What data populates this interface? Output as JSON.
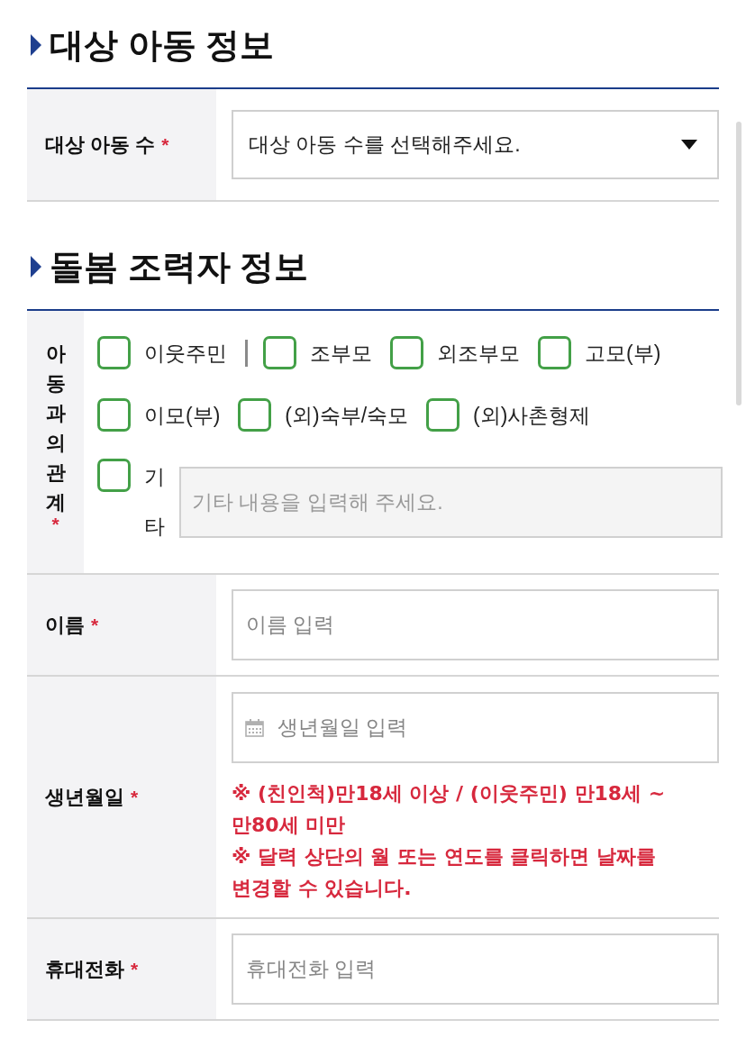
{
  "sections": [
    {
      "title": "대상 아동 정보",
      "rows": [
        {
          "kind": "select",
          "label": "대상 아동 수",
          "required_mark": "*",
          "value": "대상 아동 수를 선택해주세요."
        }
      ]
    },
    {
      "title": "돌봄 조력자 정보",
      "rows": [
        {
          "kind": "checkbox_group",
          "label": "아동과의관계",
          "required_mark": "*",
          "option_groups": [
            [
              {
                "label": "이웃주민",
                "checked": false
              }
            ],
            [
              {
                "label": "조부모",
                "checked": false
              },
              {
                "label": "외조부모",
                "checked": false
              },
              {
                "label": "고모(부)",
                "checked": false
              },
              {
                "label": "이모(부)",
                "checked": false
              },
              {
                "label": "(외)숙부/숙모",
                "checked": false
              },
              {
                "label": "(외)사촌형제",
                "checked": false
              }
            ]
          ],
          "other": {
            "label": "기타",
            "checked": false,
            "placeholder": "기타 내용을 입력해 주세요.",
            "disabled": true
          }
        },
        {
          "kind": "text",
          "label": "이름",
          "required_mark": "*",
          "placeholder": "이름 입력"
        },
        {
          "kind": "date",
          "label": "생년월일",
          "required_mark": "*",
          "placeholder": "생년월일 입력",
          "notes": [
            "※ (친인척)만18세 이상 / (이웃주민) 만18세 ~ 만80세 미만",
            "※ 달력 상단의 월 또는 연도를 클릭하면 날짜를 변경할 수 있습니다."
          ]
        },
        {
          "kind": "text",
          "label": "휴대전화",
          "required_mark": "*",
          "placeholder": "휴대전화 입력"
        }
      ]
    }
  ]
}
